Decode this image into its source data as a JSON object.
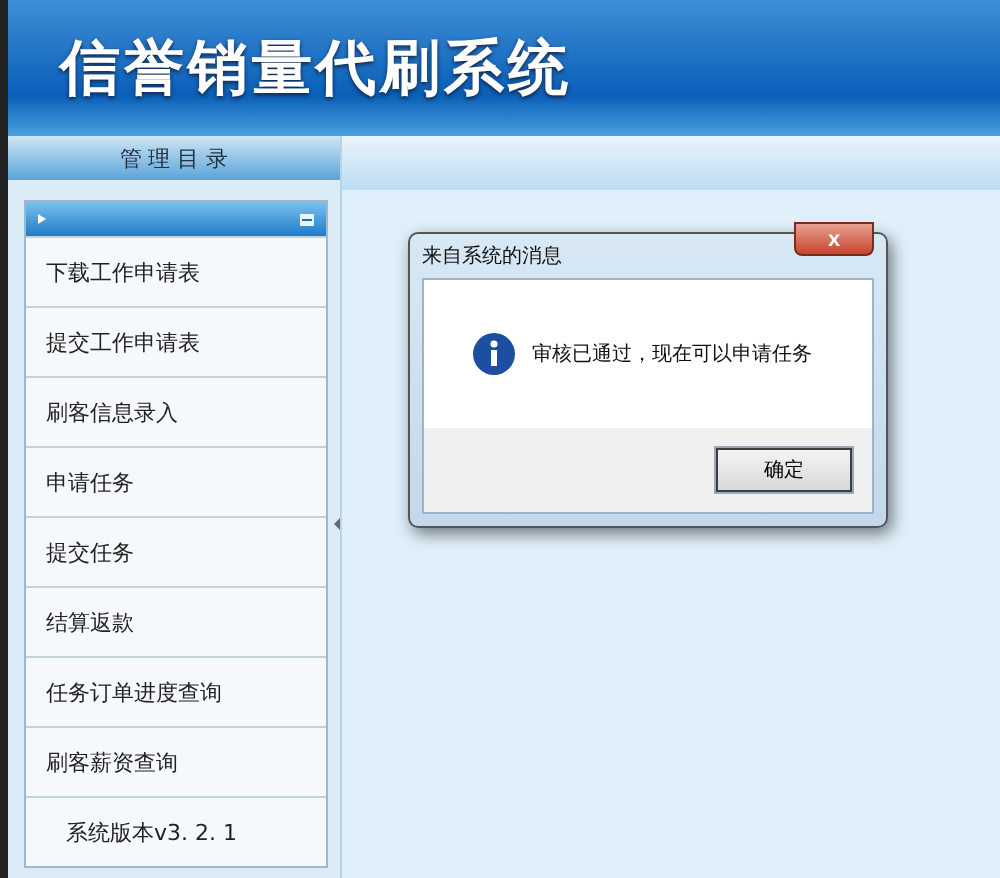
{
  "header": {
    "title": "信誉销量代刷系统"
  },
  "sidebar": {
    "title": "管 理 目 录",
    "items": [
      {
        "label": "下载工作申请表"
      },
      {
        "label": "提交工作申请表"
      },
      {
        "label": "刷客信息录入"
      },
      {
        "label": "申请任务"
      },
      {
        "label": "提交任务"
      },
      {
        "label": "结算返款"
      },
      {
        "label": "任务订单进度查询"
      },
      {
        "label": "刷客薪资查询"
      }
    ],
    "version": "系统版本v3. 2. 1"
  },
  "dialog": {
    "title": "来自系统的消息",
    "close": "x",
    "message": "审核已通过，现在可以申请任务",
    "button": "确定"
  }
}
